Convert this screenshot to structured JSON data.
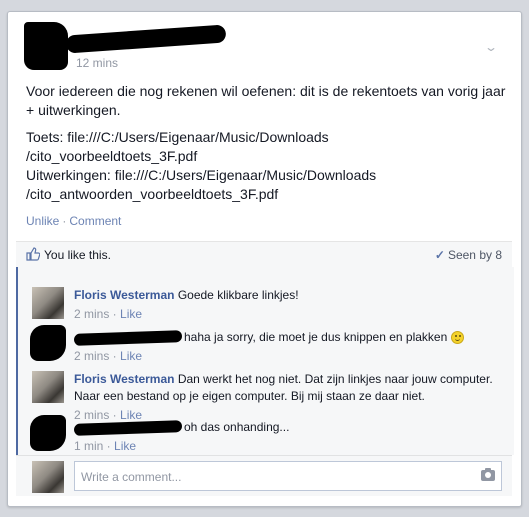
{
  "post": {
    "timestamp": "12 mins",
    "paragraph1": "Voor iedereen die nog rekenen wil oefenen: dit is de rekentoets van vorig jaar + uitwerkingen.",
    "lines": [
      "Toets: file:///C:/Users/Eigenaar/Music/Downloads",
      "/cito_voorbeeldtoets_3F.pdf",
      "Uitwerkingen: file:///C:/Users/Eigenaar/Music/Downloads",
      "/cito_antwoorden_voorbeeldtoets_3F.pdf"
    ],
    "unlike": "Unlike",
    "separator": "·",
    "comment": "Comment"
  },
  "likes": {
    "text": "You like this.",
    "seen": "Seen by 8"
  },
  "comments": [
    {
      "author": "Floris Westerman",
      "text": "Goede klikbare linkjes!",
      "time": "2 mins",
      "like": "Like"
    },
    {
      "author": "",
      "text": "haha ja sorry, die moet je dus knippen en plakken",
      "time": "2 mins",
      "like": "Like"
    },
    {
      "author": "Floris Westerman",
      "text": "Dan werkt het nog niet. Dat zijn linkjes naar jouw computer. Naar een bestand op je eigen computer. Bij mij staan ze daar niet.",
      "time": "2 mins",
      "like": "Like"
    },
    {
      "author": "",
      "text": "oh das onhanding...",
      "time": "1 min",
      "like": "Like"
    }
  ],
  "write": {
    "placeholder": "Write a comment..."
  },
  "colors": {
    "link": "#3b5998",
    "meta": "#9197a3",
    "accent_border": "#4e69a2"
  }
}
